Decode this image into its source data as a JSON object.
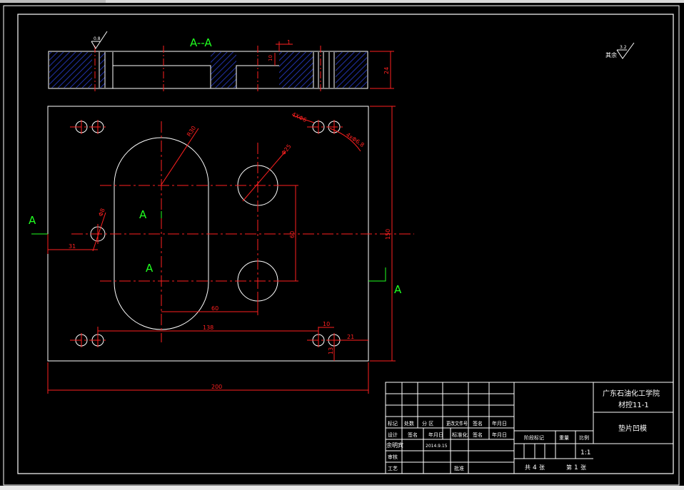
{
  "section_labels": {
    "section_title": "A--A",
    "cut_left": "A",
    "cut_right": "A",
    "inner_a1": "A",
    "inner_a2": "A"
  },
  "roughness": {
    "corner_symbol_text": "其余",
    "corner_value": "3.2",
    "section_value": "0.8"
  },
  "dimensions": {
    "sec_dim_1": "1",
    "sec_dim_10": "10",
    "sec_dim_24": "24",
    "r30": "R30",
    "phi25": "Φ25",
    "phi8": "Φ8",
    "holes": "4XΦ6",
    "holes2": "4xΦ6.8",
    "d31": "31",
    "d60": "60",
    "d138": "138",
    "d10": "10",
    "d21": "21",
    "d13": "13",
    "d150": "150",
    "d200": "200",
    "d60v": "60"
  },
  "title_block": {
    "school": "广东石油化工学院",
    "class": "材控11-1",
    "part_name": "垫片凹模",
    "col_mark": "标记",
    "col_count": "处数",
    "col_zone": "分 区",
    "col_docno": "更改文件号",
    "col_sign": "签名",
    "col_date": "年月日",
    "design": "设计",
    "sign2": "签名",
    "date2": "年月日",
    "std": "标准化",
    "sign3": "签名",
    "date3": "年月日",
    "designer": "余明宾",
    "design_date": "2014.9.15",
    "check": "审核",
    "process": "工艺",
    "approve": "批准",
    "stage_mark": "阶段标记",
    "weight": "重量",
    "scale": "比例",
    "scale_value": "1:1",
    "total": "共",
    "total_n": "4",
    "sheets": "张",
    "page": "第",
    "page_n": "1",
    "sheet": "张"
  },
  "colors": {
    "outline": "#ffffff",
    "center": "#ff2020",
    "dim": "#ff2020",
    "label": "#20ff20",
    "hatch": "#1a2a9a"
  }
}
